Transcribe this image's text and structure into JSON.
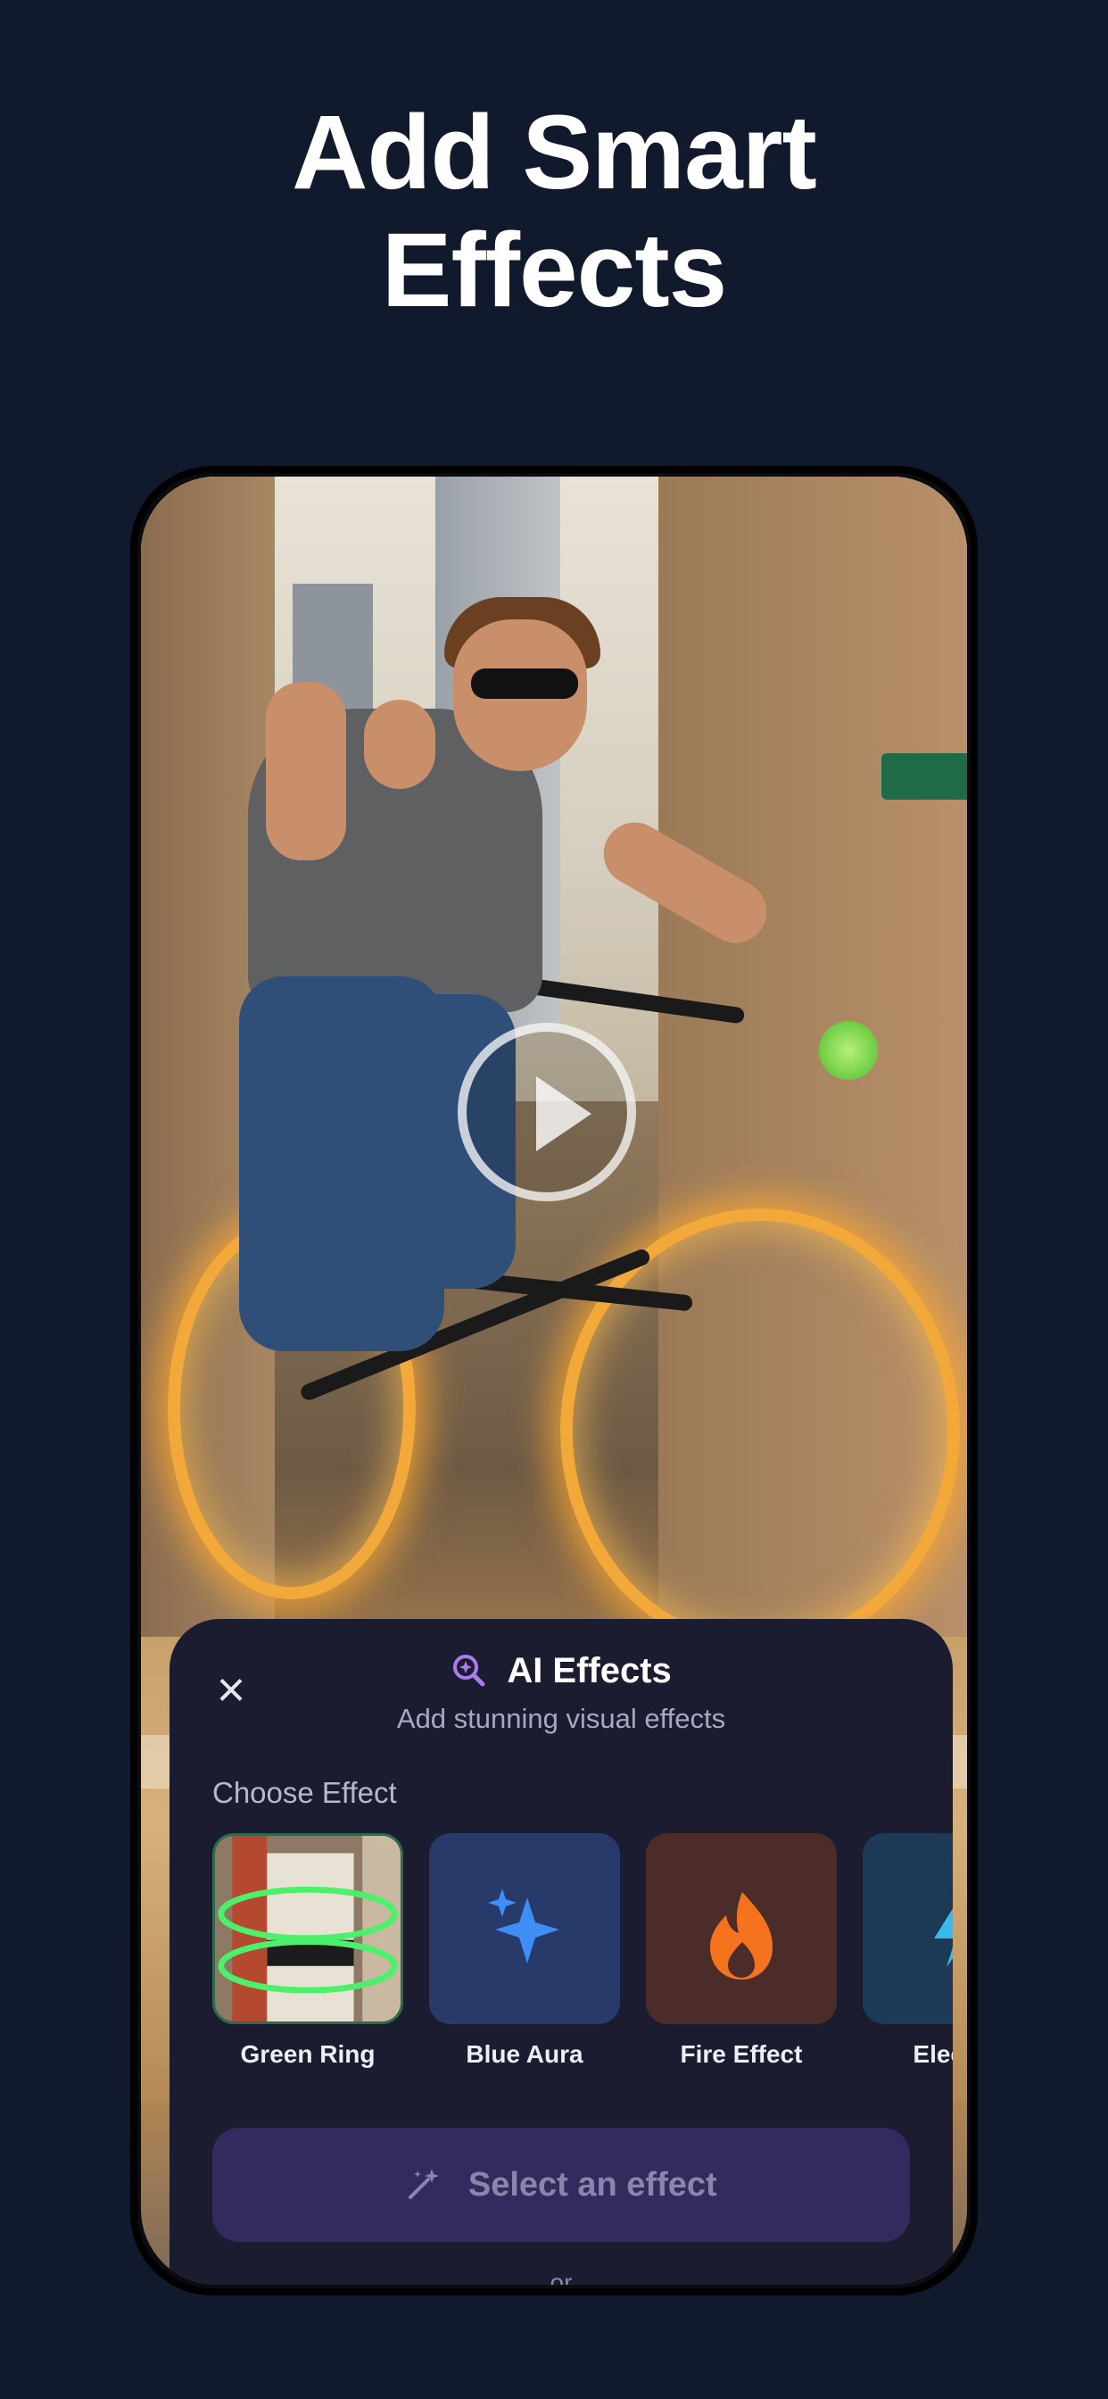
{
  "headline": {
    "line1": "Add Smart",
    "line2": "Effects"
  },
  "sheet": {
    "close_icon": "close-icon",
    "title_icon": "sparkle-search-icon",
    "title": "AI Effects",
    "subtitle": "Add stunning visual effects",
    "section_label": "Choose Effect",
    "effects": [
      {
        "label": "Green Ring",
        "icon": "green-ring-thumbnail",
        "color": "#3c3028"
      },
      {
        "label": "Blue Aura",
        "icon": "sparkles-icon",
        "color": "#273a6a"
      },
      {
        "label": "Fire Effect",
        "icon": "flame-icon",
        "color": "#4b2c28"
      },
      {
        "label": "Electric",
        "icon": "lightning-icon",
        "color": "#1c3a55"
      }
    ],
    "select_button": "Select an effect",
    "or_label": "or"
  },
  "colors": {
    "background": "#111a2c",
    "sheet": "#1b1c30",
    "accent": "#a97cf2",
    "button": "#342a5e"
  }
}
